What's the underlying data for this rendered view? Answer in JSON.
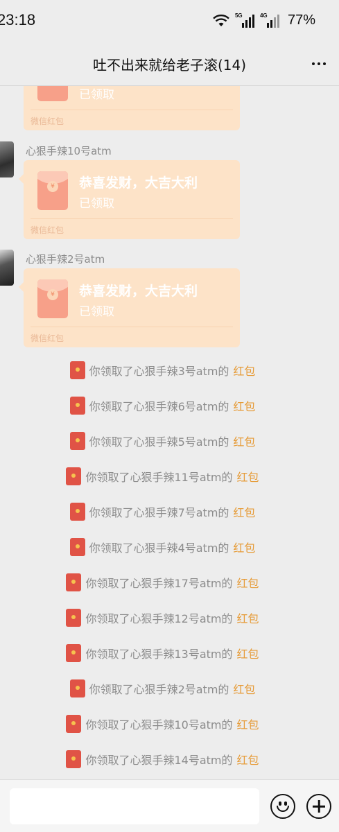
{
  "status_bar": {
    "time": "23:18",
    "net1": "5G",
    "net2": "4G",
    "battery": "77%"
  },
  "header": {
    "title": "吐不出来就给老子滚(14)"
  },
  "messages": [
    {
      "sender": "",
      "greeting": "",
      "status": "已领取",
      "label": "微信红包"
    },
    {
      "sender": "心狠手辣10号atm",
      "greeting": "恭喜发财，大吉大利",
      "status": "已领取",
      "label": "微信红包"
    },
    {
      "sender": "心狠手辣2号atm",
      "greeting": "恭喜发财，大吉大利",
      "status": "已领取",
      "label": "微信红包"
    }
  ],
  "system_notices": [
    {
      "text": "你领取了心狠手辣3号atm的",
      "link": "红包"
    },
    {
      "text": "你领取了心狠手辣6号atm的",
      "link": "红包"
    },
    {
      "text": "你领取了心狠手辣5号atm的",
      "link": "红包"
    },
    {
      "text": "你领取了心狠手辣11号atm的",
      "link": "红包"
    },
    {
      "text": "你领取了心狠手辣7号atm的",
      "link": "红包"
    },
    {
      "text": "你领取了心狠手辣4号atm的",
      "link": "红包"
    },
    {
      "text": "你领取了心狠手辣17号atm的",
      "link": "红包"
    },
    {
      "text": "你领取了心狠手辣12号atm的",
      "link": "红包"
    },
    {
      "text": "你领取了心狠手辣13号atm的",
      "link": "红包"
    },
    {
      "text": "你领取了心狠手辣2号atm的",
      "link": "红包"
    },
    {
      "text": "你领取了心狠手辣10号atm的",
      "link": "红包"
    },
    {
      "text": "你领取了心狠手辣14号atm的",
      "link": "红包"
    }
  ],
  "input_bar": {
    "emoji_icon": "emoji-icon",
    "plus_icon": "plus-icon"
  },
  "colors": {
    "background": "#ededed",
    "red_packet": "#fde3c8",
    "link": "#e69b37"
  }
}
